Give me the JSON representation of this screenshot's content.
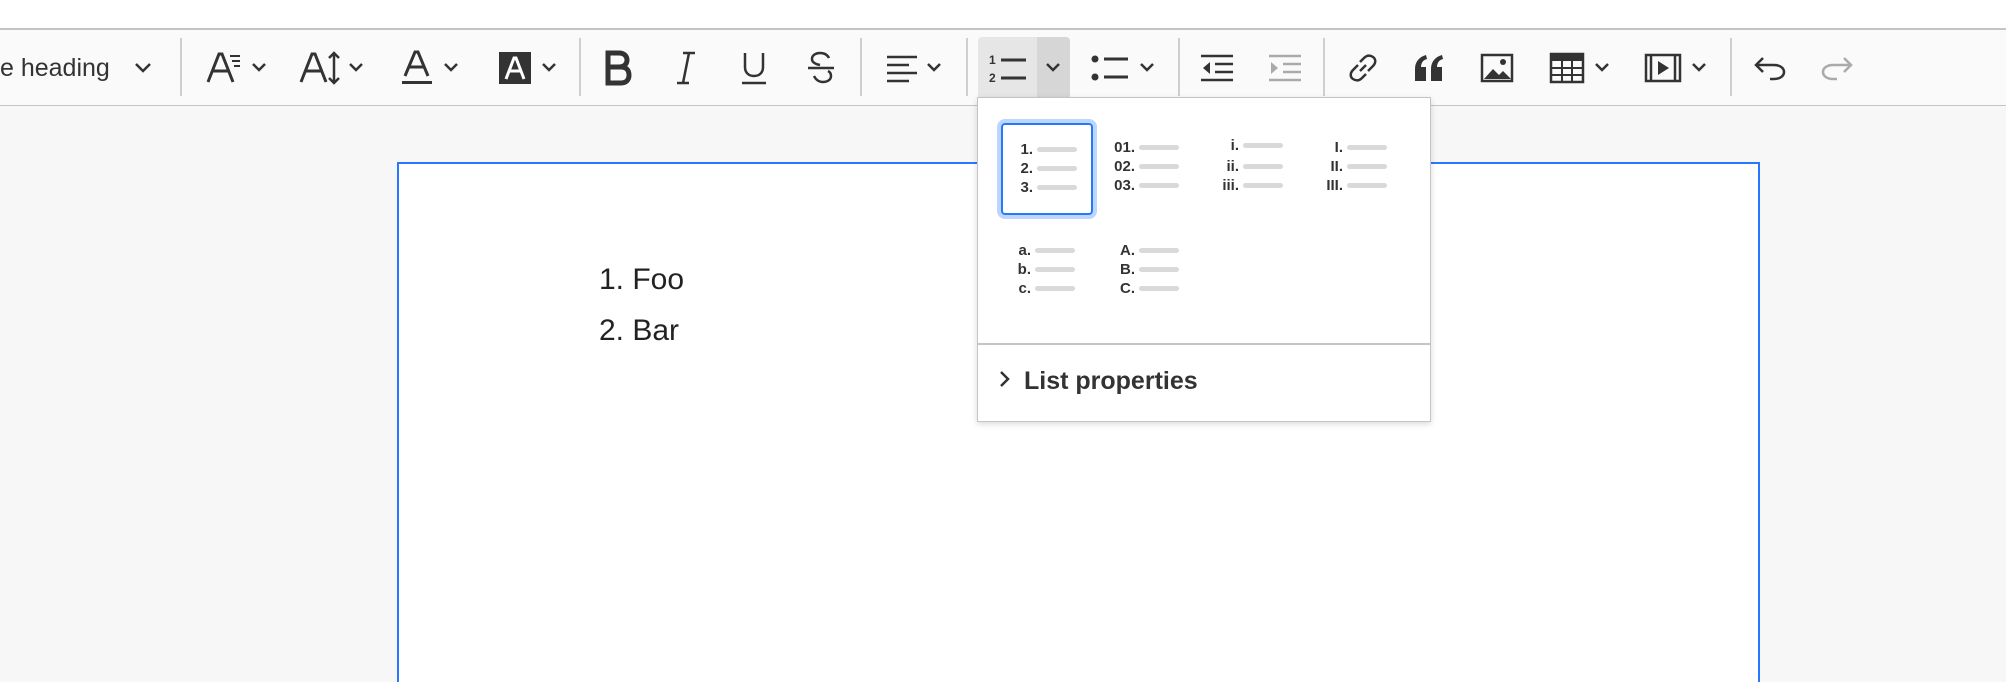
{
  "toolbar": {
    "heading_label": "e heading",
    "buttons": [
      "heading-dropdown",
      "font-family",
      "font-size",
      "font-color",
      "font-background-color",
      "bold",
      "italic",
      "underline",
      "strikethrough",
      "alignment",
      "numbered-list",
      "bulleted-list",
      "outdent",
      "indent",
      "link",
      "block-quote",
      "insert-image",
      "insert-table",
      "insert-media",
      "undo",
      "redo"
    ]
  },
  "editor": {
    "list_items": [
      "1. Foo",
      "2. Bar"
    ]
  },
  "list_style_dropdown": {
    "styles": [
      {
        "name": "decimal",
        "markers": [
          "1.",
          "2.",
          "3."
        ],
        "selected": true
      },
      {
        "name": "decimal-leading-zero",
        "markers": [
          "01.",
          "02.",
          "03."
        ],
        "selected": false
      },
      {
        "name": "lower-roman",
        "markers": [
          "i.",
          "ii.",
          "iii."
        ],
        "selected": false
      },
      {
        "name": "upper-roman",
        "markers": [
          "I.",
          "II.",
          "III."
        ],
        "selected": false
      },
      {
        "name": "lower-latin",
        "markers": [
          "a.",
          "b.",
          "c."
        ],
        "selected": false
      },
      {
        "name": "upper-latin",
        "markers": [
          "A.",
          "B.",
          "C."
        ],
        "selected": false
      }
    ],
    "properties_label": "List properties"
  },
  "colors": {
    "accent": "#2977ff",
    "focus_ring": "#bcd6fd",
    "toolbar_bg": "#fafafa",
    "page_bg": "#f7f7f7",
    "border": "#c4c4c4"
  }
}
